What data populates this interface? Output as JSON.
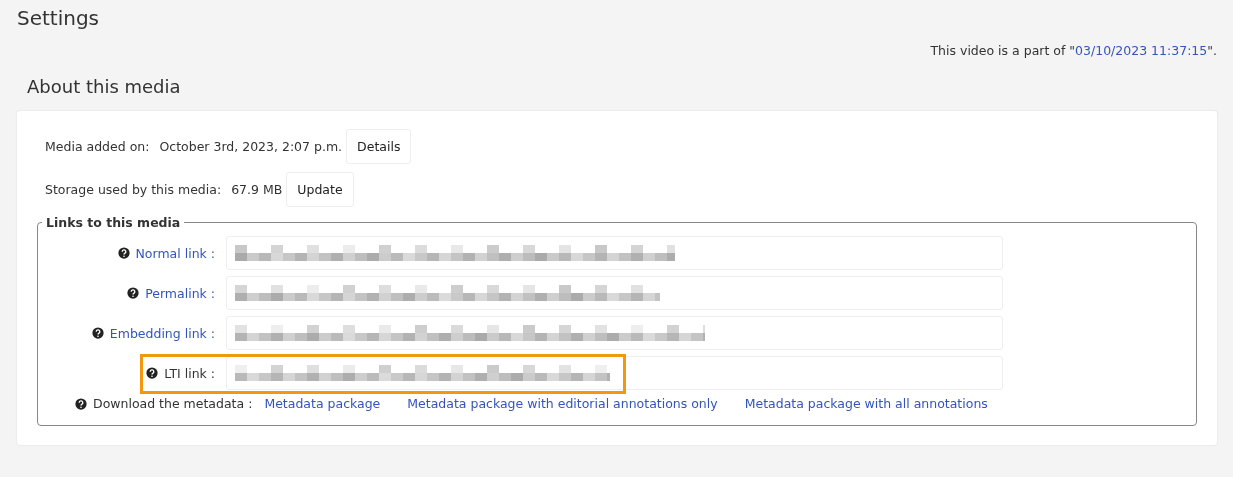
{
  "page_title": "Settings",
  "part_of": {
    "prefix": "This video is a part of \"",
    "link": "03/10/2023 11:37:15",
    "suffix": "\"."
  },
  "section_title": "About this media",
  "media_added": {
    "label": "Media added on:",
    "value": "October 3rd, 2023, 2:07 p.m.",
    "button": "Details"
  },
  "storage": {
    "label": "Storage used by this media:",
    "value": "67.9 MB",
    "button": "Update"
  },
  "links": {
    "legend": "Links to this media",
    "rows": [
      {
        "label": "Normal link :",
        "label_is_link": true,
        "value_blurred": true,
        "highlighted": false
      },
      {
        "label": "Permalink :",
        "label_is_link": true,
        "value_blurred": true,
        "highlighted": false
      },
      {
        "label": "Embedding link :",
        "label_is_link": true,
        "value_blurred": true,
        "highlighted": false
      },
      {
        "label": "LTI link :",
        "label_is_link": false,
        "value_blurred": true,
        "highlighted": true
      }
    ],
    "download": {
      "label": "Download the metadata :",
      "links": [
        "Metadata package",
        "Metadata package with editorial annotations only",
        "Metadata package with all annotations"
      ]
    }
  }
}
